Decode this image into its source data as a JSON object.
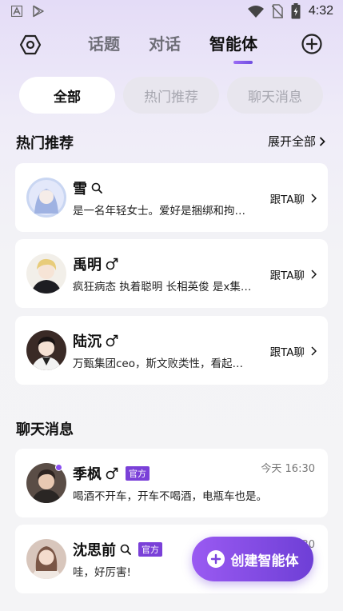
{
  "status_bar": {
    "time": "4:32",
    "icons": [
      "text-a-icon",
      "play-store-icon",
      "wifi-icon",
      "no-sim-icon",
      "battery-charging-icon"
    ]
  },
  "top_nav": {
    "settings_icon": "hexagon-settings-icon",
    "tabs": [
      {
        "label": "话题",
        "active": false
      },
      {
        "label": "对话",
        "active": false
      },
      {
        "label": "智能体",
        "active": true
      }
    ],
    "add_icon": "circle-plus-icon"
  },
  "filters": [
    {
      "label": "全部",
      "active": true
    },
    {
      "label": "热门推荐",
      "active": false
    },
    {
      "label": "聊天消息",
      "active": false
    }
  ],
  "hot_section": {
    "title": "热门推荐",
    "expand_label": "展开全部",
    "chat_label": "跟TA聊",
    "items": [
      {
        "name": "雪",
        "icon": "search-icon",
        "desc": "是一名年轻女士。爱好是捆绑和拘…"
      },
      {
        "name": "禹明",
        "icon": "male-icon",
        "desc": "疯狂病态 执着聪明 长相英俊 是x集…"
      },
      {
        "name": "陆沉",
        "icon": "male-icon",
        "desc": "万甄集团ceo，斯文败类性，看起…"
      }
    ]
  },
  "chat_section": {
    "title": "聊天消息",
    "items": [
      {
        "name": "季枫",
        "icon": "male-icon",
        "badge": "官方",
        "time": "今天 16:30",
        "message": "喝酒不开车，开车不喝酒，电瓶车也是。",
        "unread": true
      },
      {
        "name": "沈思前",
        "icon": "search-icon",
        "badge": "官方",
        "time": "今天 16:30",
        "message": "哇，好厉害!",
        "unread": false
      }
    ]
  },
  "fab": {
    "label": "创建智能体"
  },
  "colors": {
    "accent": "#7a40d8",
    "fab_start": "#9a5af2",
    "fab_end": "#6e3fd6"
  }
}
